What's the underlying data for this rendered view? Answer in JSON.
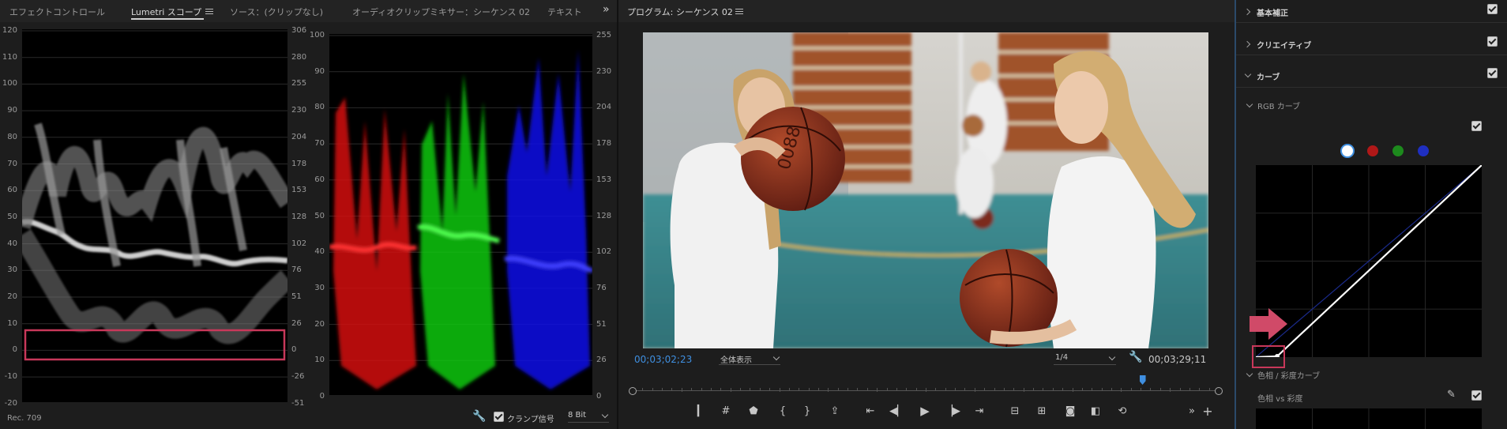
{
  "scopes_panel": {
    "tabs": [
      {
        "label": "エフェクトコントロール"
      },
      {
        "label": "Lumetri スコープ"
      },
      {
        "label": "ソース：(クリップなし)"
      },
      {
        "label": "オーディオクリップミキサー：シーケンス 02"
      },
      {
        "label": "テキスト"
      }
    ],
    "overflow_icon": "double-chevron-right",
    "waveform": {
      "left_ticks": [
        "120",
        "110",
        "100",
        "90",
        "80",
        "70",
        "60",
        "50",
        "40",
        "30",
        "20",
        "10",
        "0",
        "-10",
        "-20"
      ],
      "right_ticks": [
        "306",
        "280",
        "255",
        "230",
        "204",
        "178",
        "153",
        "128",
        "102",
        "76",
        "51",
        "26",
        "0",
        "-26",
        "-51"
      ],
      "highlight_color": "#c8385a"
    },
    "parade": {
      "left_ticks": [
        "100",
        "90",
        "80",
        "70",
        "60",
        "50",
        "40",
        "30",
        "20",
        "10",
        "0"
      ],
      "right_ticks": [
        "255",
        "230",
        "204",
        "178",
        "153",
        "128",
        "102",
        "76",
        "51",
        "26",
        "0"
      ]
    },
    "bottom": {
      "colorspace": "Rec. 709",
      "clamp_label": "クランプ信号",
      "bit_depth": "8 Bit"
    }
  },
  "program": {
    "title": "プログラム: シーケンス 02",
    "timecode_current": "00;03;02;23",
    "zoom": "全体表示",
    "resolution": "1/4",
    "timecode_duration": "00;03;29;11",
    "playhead_fraction": 0.87,
    "accent": "#3f8fe0"
  },
  "lumetri": {
    "sections": [
      {
        "label": "基本補正",
        "enabled": true
      },
      {
        "label": "クリエイティブ",
        "enabled": true
      },
      {
        "label": "カーブ",
        "enabled": true
      }
    ],
    "rgb_curve_label": "RGB カーブ",
    "hue_sat_curve_label": "色相 / 彩度カーブ",
    "hue_vs_sat_label": "色相 vs 彩度",
    "channel_colors": [
      "#ffffff",
      "#b01818",
      "#1d8a1d",
      "#1f2fc0"
    ],
    "arrow_color": "#d04a68"
  }
}
